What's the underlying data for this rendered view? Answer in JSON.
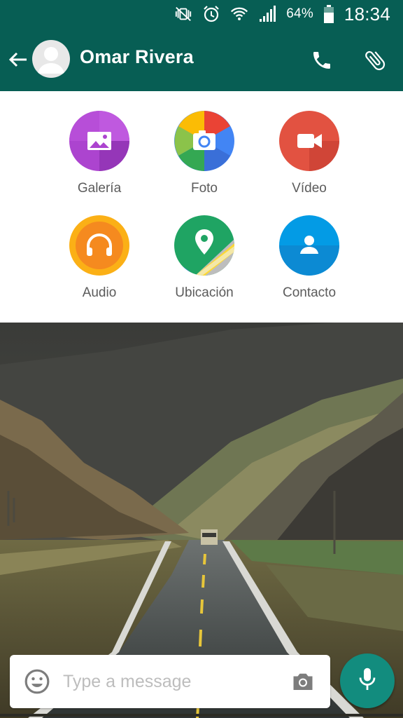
{
  "status_bar": {
    "battery_percent": "64%",
    "time": "18:34",
    "icons": [
      "mute-vibrate-icon",
      "alarm-icon",
      "wifi-icon",
      "signal-icon",
      "battery-icon"
    ]
  },
  "header": {
    "contact_name": "Omar Rivera",
    "icons": [
      "back-arrow-icon",
      "avatar",
      "phone-icon",
      "paperclip-icon"
    ]
  },
  "attach_menu": {
    "items": [
      {
        "label": "Galería",
        "icon": "gallery-icon",
        "color": "#ac44cf"
      },
      {
        "label": "Foto",
        "icon": "camera-icon",
        "color": "#4285f4"
      },
      {
        "label": "Vídeo",
        "icon": "video-icon",
        "color": "#e25241"
      },
      {
        "label": "Audio",
        "icon": "headphones-icon",
        "color": "#f58a1f"
      },
      {
        "label": "Ubicación",
        "icon": "location-pin-icon",
        "color": "#1fa463"
      },
      {
        "label": "Contacto",
        "icon": "contact-person-icon",
        "color": "#039be5"
      }
    ]
  },
  "composer": {
    "placeholder": "Type a message",
    "icons": [
      "emoji-icon",
      "camera-icon",
      "mic-icon"
    ]
  },
  "colors": {
    "header": "#075e54",
    "accent": "#128c7e"
  }
}
